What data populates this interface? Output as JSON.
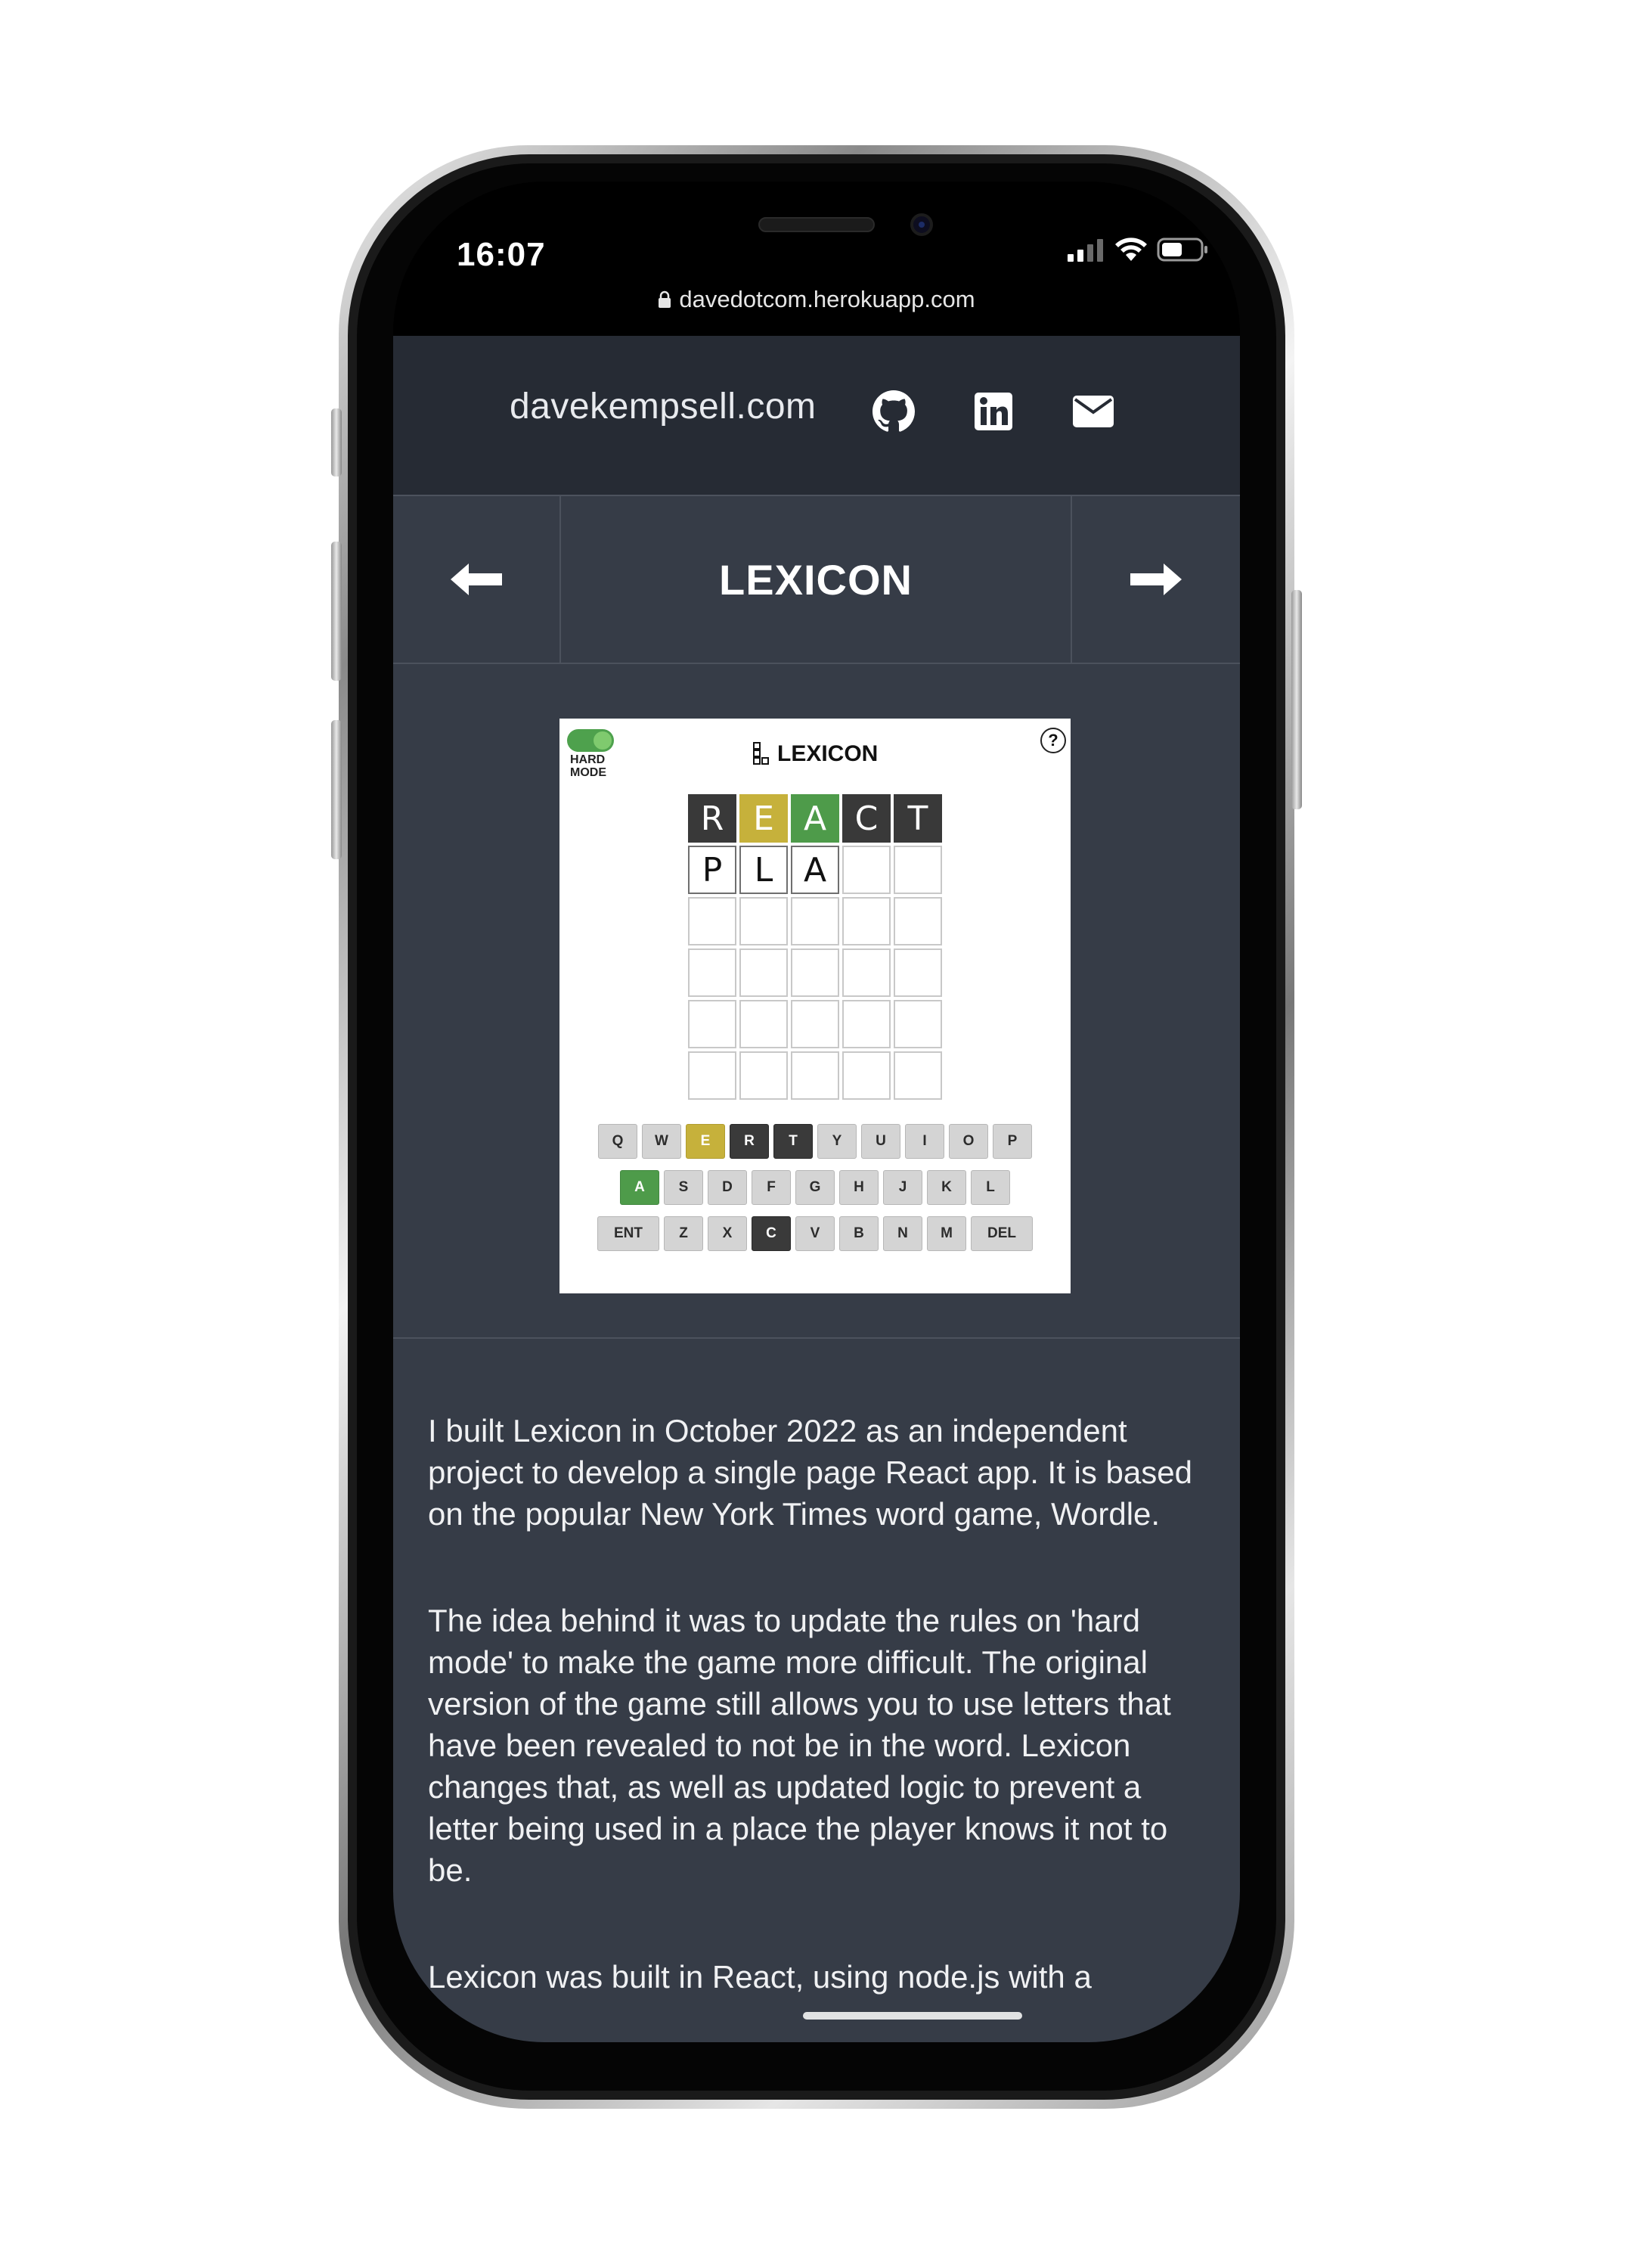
{
  "status_bar": {
    "time": "16:07",
    "url": "davedotcom.herokuapp.com",
    "icons": [
      "signal-icon",
      "wifi-icon",
      "battery-icon"
    ]
  },
  "header": {
    "site_title": "davekempsell.com",
    "icons": [
      "github-icon",
      "linkedin-icon",
      "mail-icon"
    ]
  },
  "project_nav": {
    "title": "LEXICON",
    "prev_icon": "arrow-left-icon",
    "next_icon": "arrow-right-icon"
  },
  "game_screenshot": {
    "title": "LEXICON",
    "hard_mode_label_1": "HARD",
    "hard_mode_label_2": "MODE",
    "help_glyph": "?",
    "colors": {
      "correct": "#4e9b4a",
      "present": "#c6b13b",
      "absent": "#393939",
      "background": "#363c47"
    },
    "grid": [
      [
        {
          "l": "R",
          "s": "absent"
        },
        {
          "l": "E",
          "s": "present"
        },
        {
          "l": "A",
          "s": "correct"
        },
        {
          "l": "C",
          "s": "absent"
        },
        {
          "l": "T",
          "s": "absent"
        }
      ],
      [
        {
          "l": "P",
          "s": "typed"
        },
        {
          "l": "L",
          "s": "typed"
        },
        {
          "l": "A",
          "s": "typed"
        },
        {
          "l": "",
          "s": "empty"
        },
        {
          "l": "",
          "s": "empty"
        }
      ],
      [
        {
          "l": "",
          "s": "empty"
        },
        {
          "l": "",
          "s": "empty"
        },
        {
          "l": "",
          "s": "empty"
        },
        {
          "l": "",
          "s": "empty"
        },
        {
          "l": "",
          "s": "empty"
        }
      ],
      [
        {
          "l": "",
          "s": "empty"
        },
        {
          "l": "",
          "s": "empty"
        },
        {
          "l": "",
          "s": "empty"
        },
        {
          "l": "",
          "s": "empty"
        },
        {
          "l": "",
          "s": "empty"
        }
      ],
      [
        {
          "l": "",
          "s": "empty"
        },
        {
          "l": "",
          "s": "empty"
        },
        {
          "l": "",
          "s": "empty"
        },
        {
          "l": "",
          "s": "empty"
        },
        {
          "l": "",
          "s": "empty"
        }
      ],
      [
        {
          "l": "",
          "s": "empty"
        },
        {
          "l": "",
          "s": "empty"
        },
        {
          "l": "",
          "s": "empty"
        },
        {
          "l": "",
          "s": "empty"
        },
        {
          "l": "",
          "s": "empty"
        }
      ]
    ],
    "keyboard": [
      [
        {
          "k": "Q"
        },
        {
          "k": "W"
        },
        {
          "k": "E",
          "s": "present"
        },
        {
          "k": "R",
          "s": "absent"
        },
        {
          "k": "T",
          "s": "absent"
        },
        {
          "k": "Y"
        },
        {
          "k": "U"
        },
        {
          "k": "I"
        },
        {
          "k": "O"
        },
        {
          "k": "P"
        }
      ],
      [
        {
          "k": "A",
          "s": "correct"
        },
        {
          "k": "S"
        },
        {
          "k": "D"
        },
        {
          "k": "F"
        },
        {
          "k": "G"
        },
        {
          "k": "H"
        },
        {
          "k": "J"
        },
        {
          "k": "K"
        },
        {
          "k": "L"
        }
      ],
      [
        {
          "k": "ENT",
          "w": true
        },
        {
          "k": "Z"
        },
        {
          "k": "X"
        },
        {
          "k": "C",
          "s": "absent"
        },
        {
          "k": "V"
        },
        {
          "k": "B"
        },
        {
          "k": "N"
        },
        {
          "k": "M"
        },
        {
          "k": "DEL",
          "w": true
        }
      ]
    ]
  },
  "description": {
    "p1": "I built Lexicon in October 2022 as an independent project to develop a single page React app. It is based on the popular New York Times word game, Wordle.",
    "p2": "The idea behind it was to update the rules on 'hard mode' to make the game more difficult. The original version of the game still allows you to use letters that have been revealed to not be in the word. Lexicon changes that, as well as updated logic to prevent a letter being used in a place the player knows it not to be.",
    "p3": "Lexicon was built in React, using node.js with a"
  }
}
